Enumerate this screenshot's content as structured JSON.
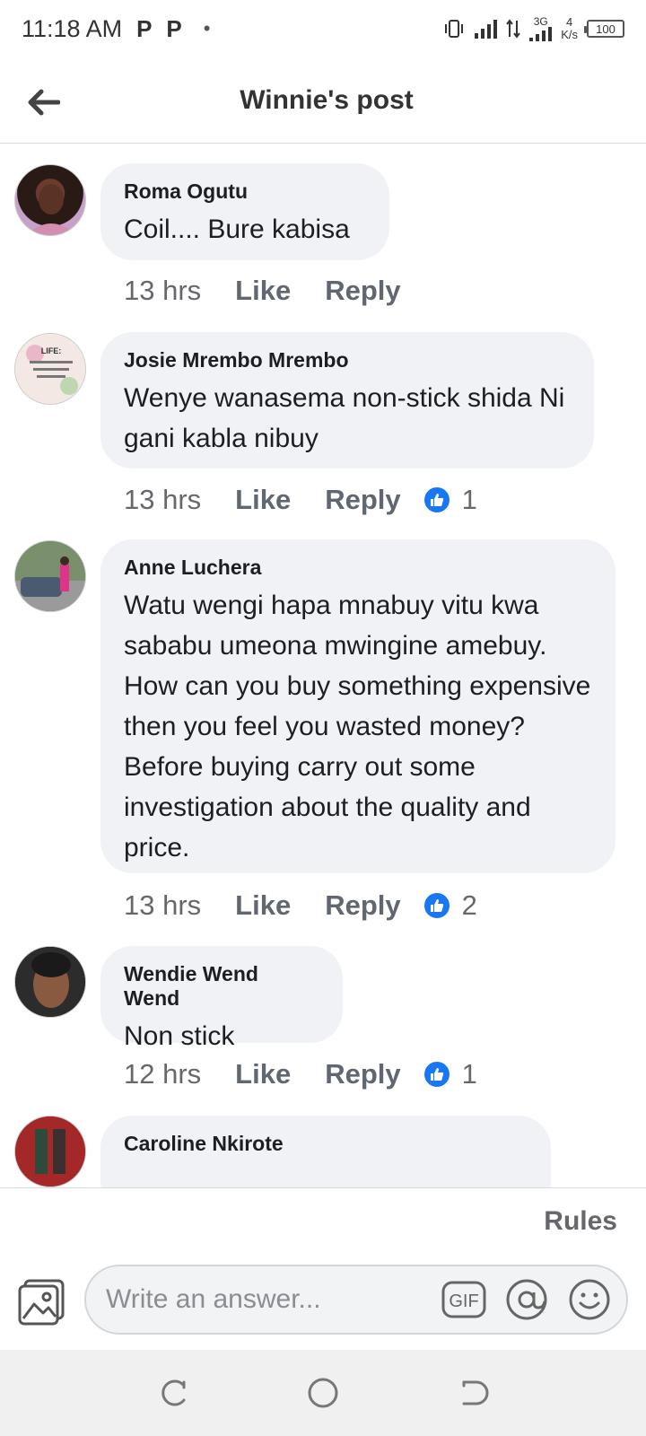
{
  "status_bar": {
    "time": "11:18 AM",
    "notif_1": "P",
    "notif_2": "P",
    "notif_dot": "•",
    "network": "3G",
    "speed_value": "4",
    "speed_unit": "K/s",
    "battery": "100"
  },
  "header": {
    "title": "Winnie's post"
  },
  "comments": [
    {
      "author": "Roma Ogutu",
      "text": "Coil.... Bure kabisa",
      "time": "13 hrs",
      "like_label": "Like",
      "reply_label": "Reply",
      "likes": ""
    },
    {
      "author": "Josie Mrembo Mrembo",
      "text": "Wenye wanasema non-stick shida Ni gani kabla nibuy",
      "time": "13 hrs",
      "like_label": "Like",
      "reply_label": "Reply",
      "likes": "1",
      "avatar_text": "LIFE:"
    },
    {
      "author": "Anne Luchera",
      "text": "Watu wengi hapa mnabuy vitu kwa sababu umeona mwingine amebuy. How can you buy something expensive then you feel you wasted money? Before buying carry out some investigation about the quality and price.",
      "time": "13 hrs",
      "like_label": "Like",
      "reply_label": "Reply",
      "likes": "2"
    },
    {
      "author": "Wendie Wend Wend",
      "text": "Non stick",
      "time": "12 hrs",
      "like_label": "Like",
      "reply_label": "Reply",
      "likes": "1"
    },
    {
      "author": "Caroline Nkirote",
      "text": "",
      "time": "",
      "like_label": "",
      "reply_label": "",
      "likes": ""
    }
  ],
  "bottom": {
    "rules_label": "Rules",
    "input_placeholder": "Write an answer...",
    "gif_label": "GIF"
  },
  "colors": {
    "bubble": "#f0f2f5",
    "like_blue": "#1877f2",
    "meta_gray": "#65676b"
  }
}
